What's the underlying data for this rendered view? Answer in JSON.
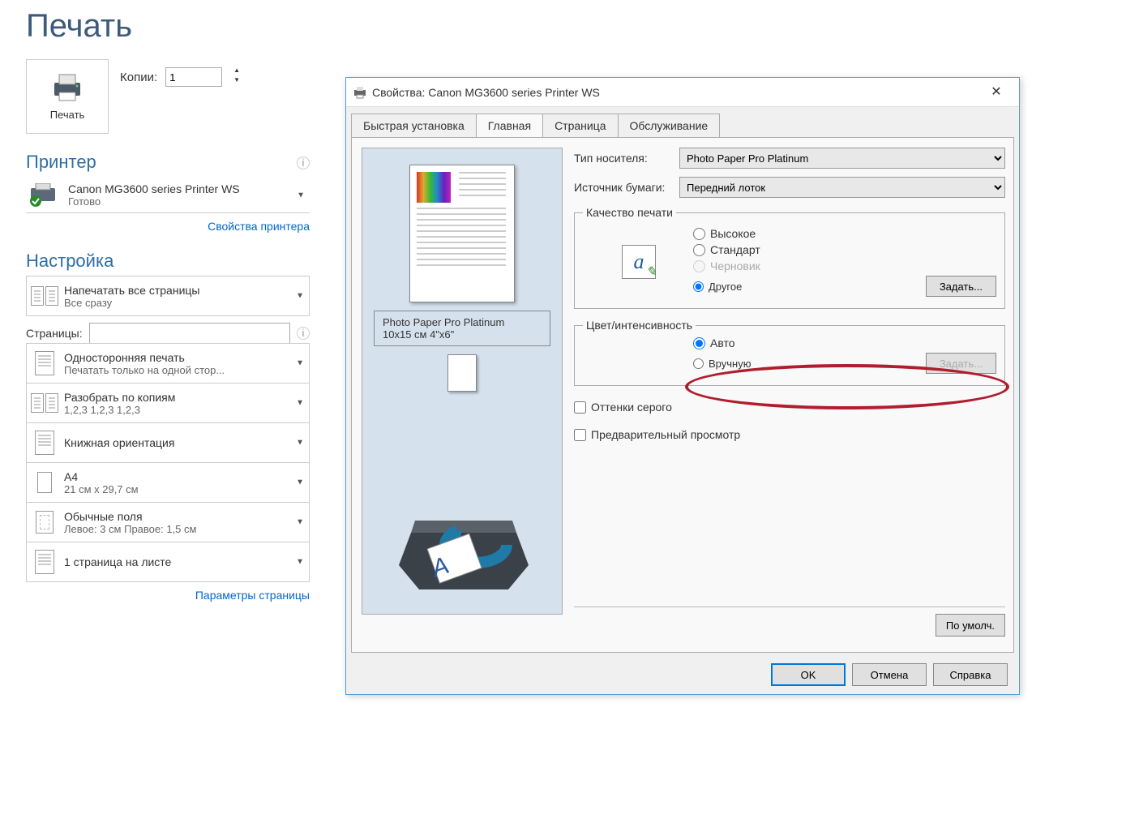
{
  "page_title": "Печать",
  "print_button": "Печать",
  "copies": {
    "label": "Копии:",
    "value": "1"
  },
  "printer_section": {
    "heading": "Принтер",
    "name": "Canon MG3600 series Printer WS",
    "status": "Готово",
    "properties_link": "Свойства принтера"
  },
  "settings_section": {
    "heading": "Настройка",
    "print_all": {
      "line1": "Напечатать все страницы",
      "line2": "Все сразу"
    },
    "pages_label": "Страницы:",
    "one_sided": {
      "line1": "Односторонняя печать",
      "line2": "Печатать только на одной стор..."
    },
    "collate": {
      "line1": "Разобрать по копиям",
      "line2": "1,2,3    1,2,3    1,2,3"
    },
    "orientation": "Книжная ориентация",
    "paper": {
      "line1": "A4",
      "line2": "21 см x 29,7 см"
    },
    "margins": {
      "line1": "Обычные поля",
      "line2": "Левое:  3 см    Правое:  1,5 см"
    },
    "per_sheet": "1 страница на листе",
    "page_setup_link": "Параметры страницы"
  },
  "dialog": {
    "title": "Свойства: Canon MG3600 series Printer WS",
    "tabs": [
      "Быстрая установка",
      "Главная",
      "Страница",
      "Обслуживание"
    ],
    "active_tab": 1,
    "preview": {
      "media": "Photo Paper Pro Platinum",
      "size": "10x15 см 4\"x6\""
    },
    "media_type": {
      "label": "Тип носителя:",
      "value": "Photo Paper Pro Platinum"
    },
    "paper_source": {
      "label": "Источник бумаги:",
      "value": "Передний лоток"
    },
    "quality": {
      "legend": "Качество печати",
      "options": [
        "Высокое",
        "Стандарт",
        "Черновик",
        "Другое"
      ],
      "selected": 3,
      "disabled": [
        2
      ],
      "set_button": "Задать..."
    },
    "color": {
      "legend": "Цвет/интенсивность",
      "options": [
        "Авто",
        "Вручную"
      ],
      "selected": 0,
      "set_button": "Задать..."
    },
    "grayscale": "Оттенки серого",
    "preview_print": "Предварительный просмотр",
    "defaults": "По умолч.",
    "buttons": {
      "ok": "OK",
      "cancel": "Отмена",
      "help": "Справка"
    }
  }
}
